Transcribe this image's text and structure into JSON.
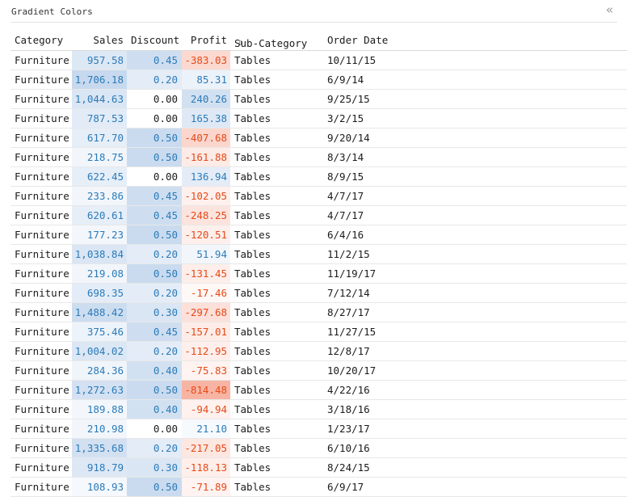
{
  "panel": {
    "title": "Gradient Colors",
    "collapse_glyph": "«"
  },
  "headers": {
    "category": "Category",
    "sales": "Sales",
    "discount": "Discount",
    "profit": "Profit",
    "sub_category": "Sub-Category",
    "sort_glyph": "⇩",
    "order_date": "Order Date"
  },
  "colors": {
    "positive_text": "#2b7bb9",
    "negative_text": "#e64a19",
    "blue_scale_max": "#c7d9ee",
    "red_scale_max": "#f8b4a3"
  },
  "rows": [
    {
      "category": "Furniture",
      "sales": "957.58",
      "discount": "0.45",
      "profit": "-383.03",
      "sub_category": "Tables",
      "order_date": "10/11/15"
    },
    {
      "category": "Furniture",
      "sales": "1,706.18",
      "discount": "0.20",
      "profit": "85.31",
      "sub_category": "Tables",
      "order_date": "6/9/14"
    },
    {
      "category": "Furniture",
      "sales": "1,044.63",
      "discount": "0.00",
      "profit": "240.26",
      "sub_category": "Tables",
      "order_date": "9/25/15"
    },
    {
      "category": "Furniture",
      "sales": "787.53",
      "discount": "0.00",
      "profit": "165.38",
      "sub_category": "Tables",
      "order_date": "3/2/15"
    },
    {
      "category": "Furniture",
      "sales": "617.70",
      "discount": "0.50",
      "profit": "-407.68",
      "sub_category": "Tables",
      "order_date": "9/20/14"
    },
    {
      "category": "Furniture",
      "sales": "218.75",
      "discount": "0.50",
      "profit": "-161.88",
      "sub_category": "Tables",
      "order_date": "8/3/14"
    },
    {
      "category": "Furniture",
      "sales": "622.45",
      "discount": "0.00",
      "profit": "136.94",
      "sub_category": "Tables",
      "order_date": "8/9/15"
    },
    {
      "category": "Furniture",
      "sales": "233.86",
      "discount": "0.45",
      "profit": "-102.05",
      "sub_category": "Tables",
      "order_date": "4/7/17"
    },
    {
      "category": "Furniture",
      "sales": "620.61",
      "discount": "0.45",
      "profit": "-248.25",
      "sub_category": "Tables",
      "order_date": "4/7/17"
    },
    {
      "category": "Furniture",
      "sales": "177.23",
      "discount": "0.50",
      "profit": "-120.51",
      "sub_category": "Tables",
      "order_date": "6/4/16"
    },
    {
      "category": "Furniture",
      "sales": "1,038.84",
      "discount": "0.20",
      "profit": "51.94",
      "sub_category": "Tables",
      "order_date": "11/2/15"
    },
    {
      "category": "Furniture",
      "sales": "219.08",
      "discount": "0.50",
      "profit": "-131.45",
      "sub_category": "Tables",
      "order_date": "11/19/17"
    },
    {
      "category": "Furniture",
      "sales": "698.35",
      "discount": "0.20",
      "profit": "-17.46",
      "sub_category": "Tables",
      "order_date": "7/12/14"
    },
    {
      "category": "Furniture",
      "sales": "1,488.42",
      "discount": "0.30",
      "profit": "-297.68",
      "sub_category": "Tables",
      "order_date": "8/27/17"
    },
    {
      "category": "Furniture",
      "sales": "375.46",
      "discount": "0.45",
      "profit": "-157.01",
      "sub_category": "Tables",
      "order_date": "11/27/15"
    },
    {
      "category": "Furniture",
      "sales": "1,004.02",
      "discount": "0.20",
      "profit": "-112.95",
      "sub_category": "Tables",
      "order_date": "12/8/17"
    },
    {
      "category": "Furniture",
      "sales": "284.36",
      "discount": "0.40",
      "profit": "-75.83",
      "sub_category": "Tables",
      "order_date": "10/20/17"
    },
    {
      "category": "Furniture",
      "sales": "1,272.63",
      "discount": "0.50",
      "profit": "-814.48",
      "sub_category": "Tables",
      "order_date": "4/22/16"
    },
    {
      "category": "Furniture",
      "sales": "189.88",
      "discount": "0.40",
      "profit": "-94.94",
      "sub_category": "Tables",
      "order_date": "3/18/16"
    },
    {
      "category": "Furniture",
      "sales": "210.98",
      "discount": "0.00",
      "profit": "21.10",
      "sub_category": "Tables",
      "order_date": "1/23/17"
    },
    {
      "category": "Furniture",
      "sales": "1,335.68",
      "discount": "0.20",
      "profit": "-217.05",
      "sub_category": "Tables",
      "order_date": "6/10/16"
    },
    {
      "category": "Furniture",
      "sales": "918.79",
      "discount": "0.30",
      "profit": "-118.13",
      "sub_category": "Tables",
      "order_date": "8/24/15"
    },
    {
      "category": "Furniture",
      "sales": "108.93",
      "discount": "0.50",
      "profit": "-71.89",
      "sub_category": "Tables",
      "order_date": "6/9/17"
    }
  ]
}
